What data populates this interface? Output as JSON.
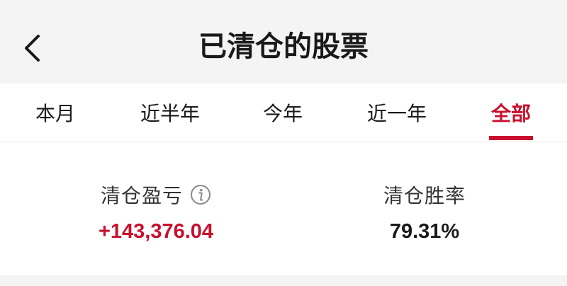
{
  "header": {
    "title": "已清仓的股票",
    "back_icon": "chevron-left-icon"
  },
  "tabs": [
    {
      "label": "本月",
      "active": false
    },
    {
      "label": "近半年",
      "active": false
    },
    {
      "label": "今年",
      "active": false
    },
    {
      "label": "近一年",
      "active": false
    },
    {
      "label": "全部",
      "active": true
    }
  ],
  "stats": {
    "profit": {
      "label": "清仓盈亏",
      "value": "+143,376.04",
      "info_icon": "info-icon"
    },
    "win_rate": {
      "label": "清仓胜率",
      "value": "79.31%"
    }
  },
  "colors": {
    "accent": "#c8102e",
    "text": "#1a1a1a",
    "background": "#f4f4f4"
  }
}
